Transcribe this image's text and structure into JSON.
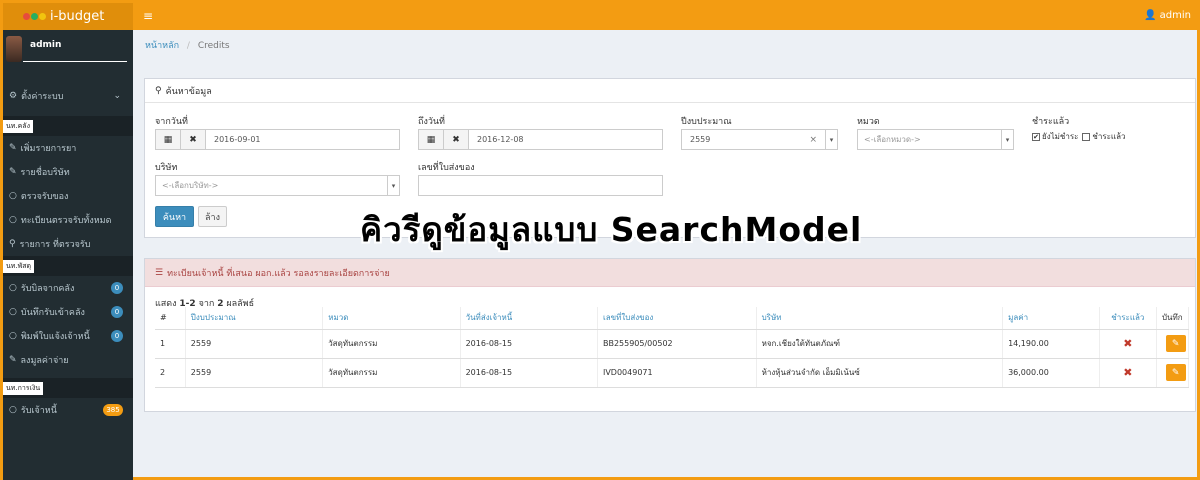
{
  "app": {
    "brand": "i-budget",
    "user": "admin"
  },
  "sidebar": {
    "username": "admin",
    "settings": "ตั้งค่าระบบ",
    "sections": [
      {
        "header": "นท.คลัง",
        "items": [
          {
            "label": "เพิ่มรายการยา",
            "icon": "pencil-icon"
          },
          {
            "label": "รายชื่อบริษัท",
            "icon": "pencil-icon"
          },
          {
            "label": "ตรวจรับของ",
            "icon": "circle-icon"
          },
          {
            "label": "ทะเบียนตรวจรับทั้งหมด",
            "icon": "circle-icon"
          },
          {
            "label": "รายการ ที่ตรวจรับ",
            "icon": "search-icon"
          }
        ]
      },
      {
        "header": "นท.พัสดุ",
        "items": [
          {
            "label": "รับบิลจากคลัง",
            "icon": "circle-icon",
            "badge": "0"
          },
          {
            "label": "บันทึกรับเข้าคลัง",
            "icon": "circle-icon",
            "badge": "0"
          },
          {
            "label": "พิมพ์ใบแจ้งเจ้าหนี้",
            "icon": "circle-icon",
            "badge": "0"
          },
          {
            "label": "ลงมูลค่าจ่าย",
            "icon": "pencil-icon"
          }
        ]
      },
      {
        "header": "นท.การเงิน",
        "items": [
          {
            "label": "รับเจ้าหนี้",
            "icon": "circle-icon",
            "badge": "385"
          }
        ]
      }
    ]
  },
  "breadcrumb": {
    "home": "หน้าหลัก",
    "sep": "/",
    "current": "Credits"
  },
  "search": {
    "title": "ค้นหาข้อมูล",
    "from_label": "จากวันที่",
    "from_value": "2016-09-01",
    "to_label": "ถึงวันที่",
    "to_value": "2016-12-08",
    "year_label": "ปีงบประมาณ",
    "year_value": "2559",
    "category_label": "หมวด",
    "category_placeholder": "<-เลือกหมวด->",
    "paid_label": "ชำระแล้ว",
    "unpaid_option": "ยังไม่ชำระ",
    "paid_option": "ชำระแล้ว",
    "company_label": "บริษัท",
    "company_placeholder": "<-เลือกบริษัท->",
    "invoice_label": "เลขที่ใบส่งของ",
    "search_button": "ค้นหา",
    "clear_button": "ล้าง"
  },
  "overlay_text": "คิวรีดูข้อมูลแบบ  SearchModel",
  "results": {
    "title": "ทะเบียนเจ้าหนี้ ที่เสนอ ผอก.แล้ว รอลงรายละเอียดการจ่าย",
    "summary_prefix": "แสดง",
    "summary_range": "1-2",
    "summary_mid": "จาก",
    "summary_total": "2",
    "summary_suffix": "ผลลัพธ์",
    "columns": [
      "#",
      "ปีงบประมาณ",
      "หมวด",
      "วันที่ส่งเจ้าหนี้",
      "เลขที่ใบส่งของ",
      "บริษัท",
      "มูลค่า",
      "ชำระแล้ว",
      "บันทึก"
    ],
    "rows": [
      {
        "no": "1",
        "year": "2559",
        "category": "วัสดุทันตกรรม",
        "date": "2016-08-15",
        "invoice": "BB255905/00502",
        "company": "หจก.เชียงใต้ทันตภัณฑ์",
        "amount": "14,190.00"
      },
      {
        "no": "2",
        "year": "2559",
        "category": "วัสดุทันตกรรม",
        "date": "2016-08-15",
        "invoice": "IVD0049071",
        "company": "ห้างหุ้นส่วนจำกัด เอ็มมิเน้นซ์",
        "amount": "36,000.00"
      }
    ]
  }
}
